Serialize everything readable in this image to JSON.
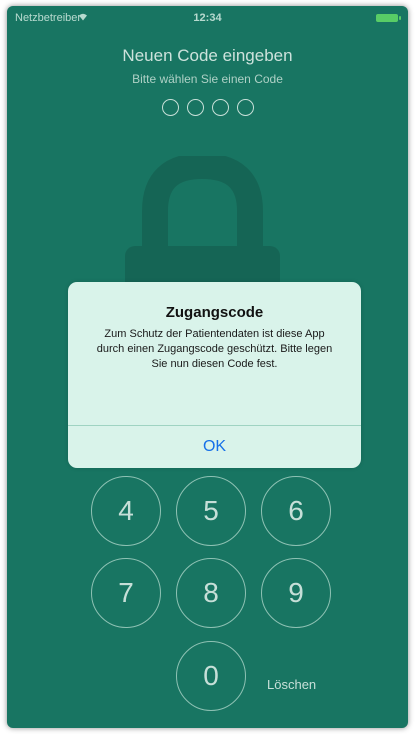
{
  "status_bar": {
    "carrier": "Netzbetreiber",
    "time": "12:34"
  },
  "lock_screen": {
    "title": "Neuen Code eingeben",
    "subtitle": "Bitte wählen Sie einen Code",
    "code_length": 4
  },
  "keypad": {
    "keys": [
      "4",
      "5",
      "6",
      "7",
      "8",
      "9",
      "0"
    ],
    "delete_label": "Löschen"
  },
  "alert": {
    "title": "Zugangscode",
    "message": "Zum Schutz der Patientendaten ist diese App durch einen Zugangscode geschützt. Bitte legen Sie nun diesen Code fest.",
    "ok_label": "OK"
  },
  "colors": {
    "background": "#1a7a66",
    "alert_background": "#d9f3ea",
    "ok_text": "#1670e8",
    "battery": "#5cd66b"
  }
}
